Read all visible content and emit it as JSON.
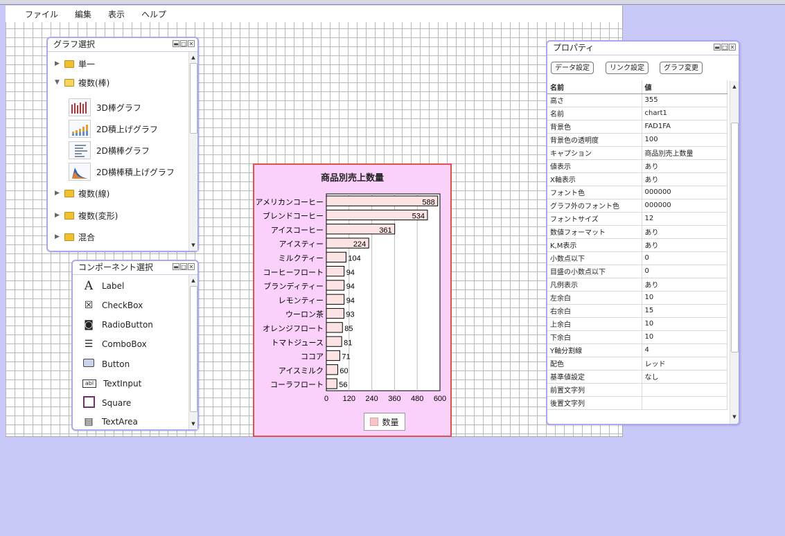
{
  "menu": [
    "ファイル",
    "編集",
    "表示",
    "ヘルプ"
  ],
  "graph_panel": {
    "title": "グラフ選択",
    "folders_top": [
      {
        "label": "単一",
        "open": false
      },
      {
        "label": "複数(棒)",
        "open": true
      }
    ],
    "charts": [
      "3D棒グラフ",
      "2D積上げグラフ",
      "2D横棒グラフ",
      "2D横棒積上げグラフ"
    ],
    "folders_bottom": [
      "複数(線)",
      "複数(変形)",
      "混合"
    ]
  },
  "component_panel": {
    "title": "コンポーネント選択",
    "items": [
      {
        "label": "Label",
        "icon": "label-icon"
      },
      {
        "label": "CheckBox",
        "icon": "checkbox-icon"
      },
      {
        "label": "RadioButton",
        "icon": "radio-icon"
      },
      {
        "label": "ComboBox",
        "icon": "combobox-icon"
      },
      {
        "label": "Button",
        "icon": "button-icon"
      },
      {
        "label": "TextInput",
        "icon": "textinput-icon"
      },
      {
        "label": "Square",
        "icon": "square-icon"
      },
      {
        "label": "TextArea",
        "icon": "textarea-icon"
      }
    ]
  },
  "chart_data": {
    "type": "bar",
    "orientation": "horizontal",
    "title": "商品別売上数量",
    "categories": [
      "アメリカンコーヒー",
      "ブレンドコーヒー",
      "アイスコーヒー",
      "アイスティー",
      "ミルクティー",
      "コーヒーフロート",
      "ブランディティー",
      "レモンティー",
      "ウーロン茶",
      "オレンジフロート",
      "トマトジュース",
      "ココア",
      "アイスミルク",
      "コーラフロート"
    ],
    "series": [
      {
        "name": "数量",
        "values": [
          588,
          534,
          361,
          224,
          104,
          94,
          94,
          94,
          93,
          85,
          81,
          71,
          60,
          56
        ]
      }
    ],
    "xlim": [
      0,
      600
    ],
    "xticks": [
      0,
      120,
      240,
      360,
      480,
      600
    ],
    "legend": "bottom",
    "background": "#fad1fa",
    "bar_color": "#f6c6c6"
  },
  "properties_panel": {
    "title": "プロパティ",
    "buttons": [
      "データ設定",
      "リンク設定",
      "グラフ変更"
    ],
    "header": {
      "name": "名前",
      "value": "値"
    },
    "rows": [
      [
        "高さ",
        "355"
      ],
      [
        "名前",
        "chart1"
      ],
      [
        "背景色",
        "FAD1FA"
      ],
      [
        "背景色の透明度",
        "100"
      ],
      [
        "キャプション",
        "商品別売上数量"
      ],
      [
        "値表示",
        "あり"
      ],
      [
        "X軸表示",
        "あり"
      ],
      [
        "フォント色",
        "000000"
      ],
      [
        "グラフ外のフォント色",
        "000000"
      ],
      [
        "フォントサイズ",
        "12"
      ],
      [
        "数値フォーマット",
        "あり"
      ],
      [
        "K,M表示",
        "あり"
      ],
      [
        "小数点以下",
        "0"
      ],
      [
        "目盛の小数点以下",
        "0"
      ],
      [
        "凡例表示",
        "あり"
      ],
      [
        "左余白",
        "10"
      ],
      [
        "右余白",
        "15"
      ],
      [
        "上余白",
        "10"
      ],
      [
        "下余白",
        "10"
      ],
      [
        "Y軸分割線",
        "4"
      ],
      [
        "配色",
        "レッド"
      ],
      [
        "基準値設定",
        "なし"
      ],
      [
        "前置文字列",
        ""
      ],
      [
        "後置文字列",
        ""
      ]
    ]
  }
}
